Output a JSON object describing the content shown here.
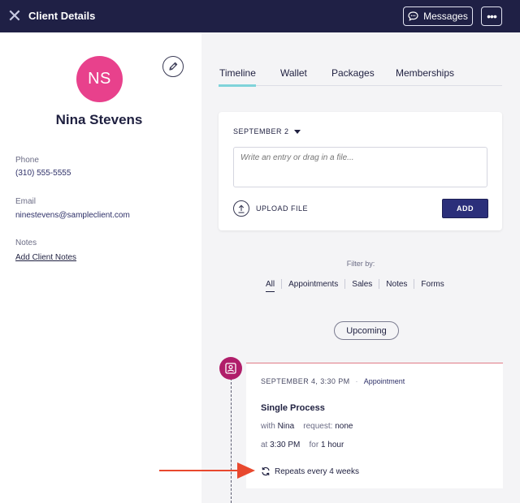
{
  "header": {
    "title": "Client Details",
    "messages_label": "Messages",
    "more_label": "•••",
    "close_label": "✕"
  },
  "client": {
    "initials": "NS",
    "name": "Nina Stevens",
    "phone_label": "Phone",
    "phone": "(310) 555-5555",
    "email_label": "Email",
    "email": "ninestevens@sampleclient.com",
    "notes_label": "Notes",
    "notes_link": "Add Client Notes",
    "avatar_color": "#e8418c"
  },
  "tabs": [
    {
      "label": "Timeline",
      "active": true
    },
    {
      "label": "Wallet",
      "active": false
    },
    {
      "label": "Packages",
      "active": false
    },
    {
      "label": "Memberships",
      "active": false
    }
  ],
  "entry": {
    "date": "SEPTEMBER 2",
    "placeholder": "Write an entry or drag in a file...",
    "upload_label": "UPLOAD FILE",
    "add_label": "ADD"
  },
  "filter": {
    "label": "Filter by:",
    "options": [
      "All",
      "Appointments",
      "Sales",
      "Notes",
      "Forms"
    ],
    "active": "All"
  },
  "upcoming_label": "Upcoming",
  "appointment": {
    "datetime": "SEPTEMBER 4, 3:30 PM",
    "dot": "·",
    "type": "Appointment",
    "title": "Single Process",
    "with_label": "with",
    "with_value": "Nina",
    "request_label": "request:",
    "request_value": "none",
    "at_label": "at",
    "at_value": "3:30 PM",
    "for_label": "for",
    "for_value": "1 hour",
    "repeat": "Repeats every 4 weeks",
    "icon_color": "#b01e6a"
  },
  "colors": {
    "header_bg": "#1f2045",
    "accent_tab": "#7fd3da",
    "add_button": "#2b2f7a",
    "annotation_arrow": "#e8482e"
  }
}
